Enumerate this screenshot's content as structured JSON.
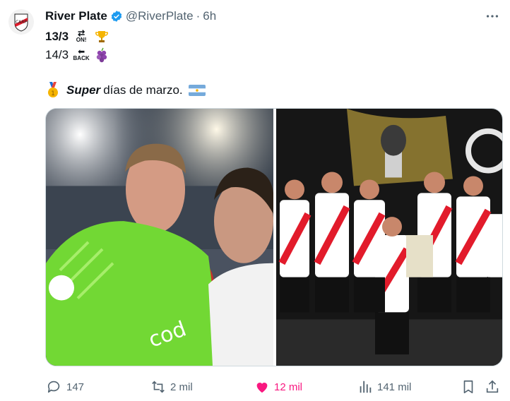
{
  "account": {
    "name": "River Plate",
    "handle": "@RiverPlate",
    "separator": "·",
    "time": "6h"
  },
  "text": {
    "line1_date": "13/3",
    "line1_tag": "ON!",
    "line2_date": "14/3",
    "line2_tag": "BACK",
    "line3_bold": "Super",
    "line3_rest": "días de marzo."
  },
  "actions": {
    "replies": "147",
    "retweets": "2 mil",
    "likes": "12 mil",
    "views": "141 mil"
  },
  "colors": {
    "accent": "#1d9bf0",
    "like": "#f91880",
    "muted": "#536471",
    "river_red": "#e21b2b",
    "keeper_green": "#7ddc2b"
  },
  "icons": [
    "more-icon",
    "verified-icon",
    "trophy-icon",
    "grapes-icon",
    "medal-icon",
    "argentina-flag-icon",
    "reply-icon",
    "retweet-icon",
    "like-icon",
    "views-icon",
    "bookmark-icon",
    "share-icon"
  ]
}
